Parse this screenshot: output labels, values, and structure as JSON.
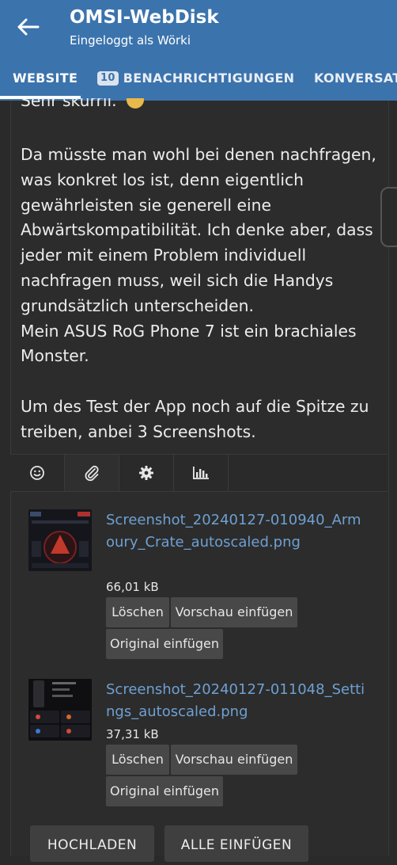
{
  "header": {
    "title": "OMSI-WebDisk",
    "subtitle": "Eingeloggt als Wörki",
    "back_icon": "arrow-left-icon"
  },
  "tabs": [
    {
      "label": "WEBSITE",
      "active": true
    },
    {
      "label": "BENACHRICHTIGUNGEN",
      "badge": "10"
    },
    {
      "label": "KONVERSATIONEN"
    }
  ],
  "post": {
    "cut_line": "Sehr skurril.",
    "paragraphs": [
      "Da müsste man wohl bei denen nachfragen, was konkret los ist, denn eigentlich gewährleisten sie generell eine Abwärtskompatibilität. Ich denke aber, dass jeder mit einem Problem individuell nachfragen muss, weil sich die Handys grundsätzlich unterscheiden.",
      "Mein ASUS RoG Phone 7 ist ein brachiales Monster.",
      "Um des Test der App noch auf die Spitze zu treiben, anbei 3 Screenshots."
    ]
  },
  "toolbar": {
    "tools": [
      "smiley-icon",
      "paperclip-icon",
      "gear-icon",
      "bar-chart-icon"
    ],
    "active_index": 1
  },
  "attachments": [
    {
      "filename": "Screenshot_20240127-010940_Armoury_Crate_autoscaled.png",
      "size": "66,01 kB",
      "delete_label": "Löschen",
      "preview_label": "Vorschau einfügen",
      "original_label": "Original einfügen",
      "thumb_icon": "armoury-crate-thumbnail"
    },
    {
      "filename": "Screenshot_20240127-011048_Settings_autoscaled.png",
      "size": "37,31 kB",
      "delete_label": "Löschen",
      "preview_label": "Vorschau einfügen",
      "original_label": "Original einfügen",
      "thumb_icon": "settings-thumbnail"
    }
  ],
  "actions": {
    "upload_label": "HOCHLADEN",
    "insert_all_label": "ALLE EINFÜGEN"
  },
  "colors": {
    "header": "#3b73ad",
    "background": "#2a2a2a",
    "link": "#6ea0d2",
    "button": "#484848"
  }
}
